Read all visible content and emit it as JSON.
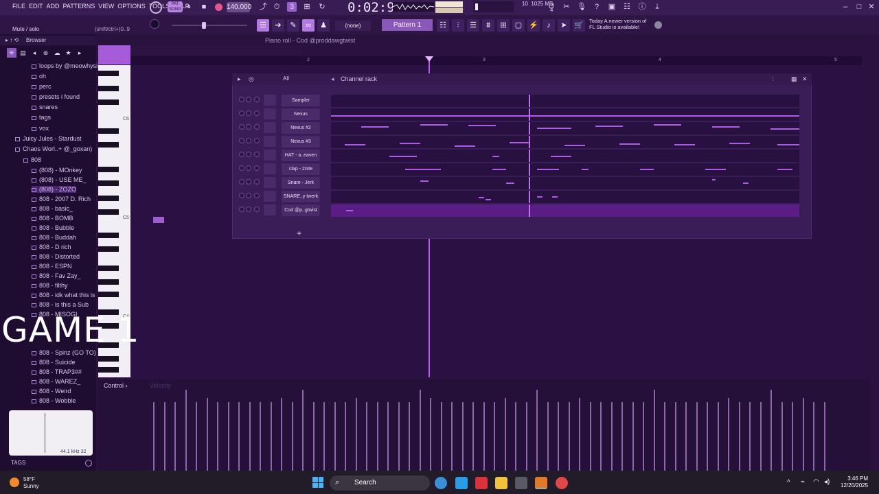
{
  "menu": [
    "FILE",
    "EDIT",
    "ADD",
    "PATTERNS",
    "VIEW",
    "OPTIONS",
    "TOOLS",
    "HELP"
  ],
  "transport": {
    "tempo": "140.000",
    "time": "0:02:90",
    "pattern": "Pattern 1",
    "snap": "(none)"
  },
  "status": {
    "memory": "1025 MB",
    "voices": "10",
    "cpu": "4"
  },
  "hint": {
    "text": "Mute / solo",
    "shortcut": "(shift/ctrl+)0..9"
  },
  "news": {
    "line1": "Today  A newer version of",
    "line2": "FL Studio is available!"
  },
  "browser": {
    "title": "Browser",
    "items": [
      "loops by @meowhysi",
      "oh",
      "perc",
      "presets i found",
      "snares",
      "tags",
      "vox",
      "Juicy Jules - Stardust",
      "Chaos Worl..+ @_goxan)",
      "808",
      "(808) - MOnkey",
      "(808) - USE ME_",
      "(808) - ZOZO",
      "808 - 2007 D. Rich",
      "808 - basic_",
      "808 - BOMB",
      "808 - Bubble",
      "808 - Buddah",
      "808 - D rich",
      "808 - Distorted",
      "808 - ESPN",
      "808 - Fav Zay_",
      "808 - filthy",
      "808 - idk what this is",
      "808 - is this a Sub",
      "808 - MISOGI",
      "808 - Spinz (GO TO)",
      "808 - Suicide",
      "808 - TRAP3##",
      "808 - WAREZ_",
      "808 - Weird",
      "808 - Wobble"
    ],
    "tags": "TAGS",
    "sample_rate": "44.1 kHz 32"
  },
  "piano_roll": {
    "title": "Piano roll - Cod @proddawgtwist",
    "key_c6": "C6",
    "key_c5": "C5",
    "key_c4": "C4",
    "ruler": [
      "2",
      "3",
      "4",
      "5"
    ]
  },
  "channel_rack": {
    "title": "Channel rack",
    "filter": "All",
    "channels": [
      "Sampler",
      "Nexus",
      "Nexus #2",
      "Nexus #3",
      "HAT - a..eaven",
      "clap - 2nite",
      "Snare - Jerk",
      "SNARE..y twerk",
      "Cod @p..gtwist"
    ]
  },
  "control": {
    "label": "Control",
    "param": "Velocity"
  },
  "overlay": {
    "text": "GAME 1"
  },
  "taskbar": {
    "weather_temp": "58°F",
    "weather_cond": "Sunny",
    "search": "Search",
    "time": "3:46 PM",
    "date": "12/20/2025"
  },
  "colors": {
    "accent": "#b05ce6",
    "background": "#2a1140"
  }
}
